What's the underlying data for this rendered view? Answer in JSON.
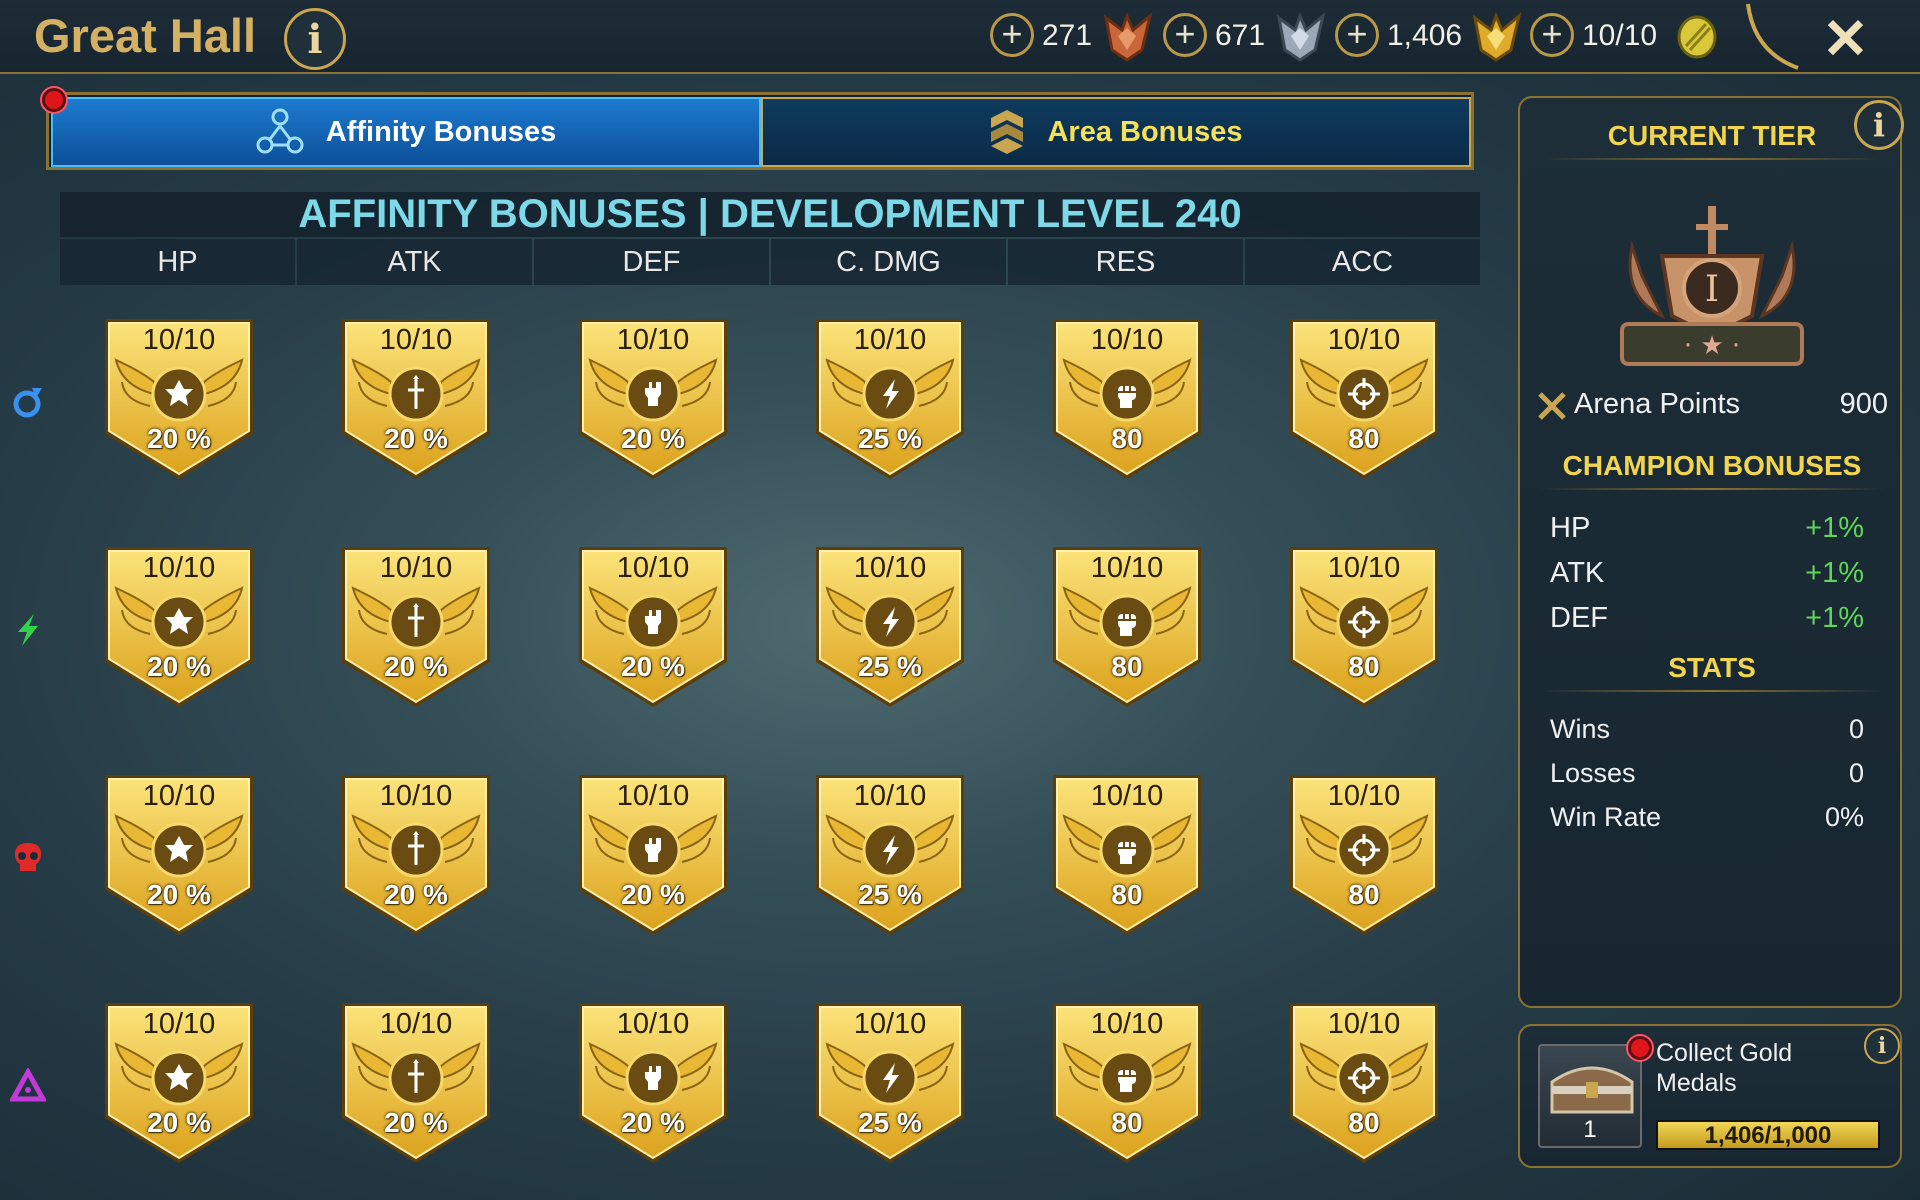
{
  "header": {
    "title": "Great Hall",
    "info": "i",
    "currencies": [
      {
        "value": "271",
        "icon": "bronze-medal-icon",
        "color": "#c9673a"
      },
      {
        "value": "671",
        "icon": "silver-medal-icon",
        "color": "#9aa8b8"
      },
      {
        "value": "1,406",
        "icon": "gold-medal-icon",
        "color": "#e0aa2a"
      },
      {
        "value": "10/10",
        "icon": "arena-token-icon",
        "color": "#d8c83a"
      }
    ],
    "plus": "+",
    "close": "✕"
  },
  "tabs": {
    "active": "Affinity Bonuses",
    "inactive": "Area Bonuses"
  },
  "panel": {
    "headline": "AFFINITY BONUSES | DEVELOPMENT LEVEL 240",
    "columns": [
      "HP",
      "ATK",
      "DEF",
      "C. DMG",
      "RES",
      "ACC"
    ]
  },
  "affinities": [
    {
      "icon": "magic-affinity-icon",
      "color": "#3a8ff0"
    },
    {
      "icon": "spirit-affinity-icon",
      "color": "#2fd44a"
    },
    {
      "icon": "force-affinity-icon",
      "color": "#e02a2a"
    },
    {
      "icon": "void-affinity-icon",
      "color": "#c33ad8"
    }
  ],
  "grid": [
    {
      "cells": [
        {
          "level": "10/10",
          "value": "20 %",
          "icon": "hp-icon"
        },
        {
          "level": "10/10",
          "value": "20 %",
          "icon": "attack-icon"
        },
        {
          "level": "10/10",
          "value": "20 %",
          "icon": "defense-icon"
        },
        {
          "level": "10/10",
          "value": "25 %",
          "icon": "crit-damage-icon"
        },
        {
          "level": "10/10",
          "value": "80",
          "icon": "resistance-icon"
        },
        {
          "level": "10/10",
          "value": "80",
          "icon": "accuracy-icon"
        }
      ]
    },
    {
      "cells": [
        {
          "level": "10/10",
          "value": "20 %",
          "icon": "hp-icon"
        },
        {
          "level": "10/10",
          "value": "20 %",
          "icon": "attack-icon"
        },
        {
          "level": "10/10",
          "value": "20 %",
          "icon": "defense-icon"
        },
        {
          "level": "10/10",
          "value": "25 %",
          "icon": "crit-damage-icon"
        },
        {
          "level": "10/10",
          "value": "80",
          "icon": "resistance-icon"
        },
        {
          "level": "10/10",
          "value": "80",
          "icon": "accuracy-icon"
        }
      ]
    },
    {
      "cells": [
        {
          "level": "10/10",
          "value": "20 %",
          "icon": "hp-icon"
        },
        {
          "level": "10/10",
          "value": "20 %",
          "icon": "attack-icon"
        },
        {
          "level": "10/10",
          "value": "20 %",
          "icon": "defense-icon"
        },
        {
          "level": "10/10",
          "value": "25 %",
          "icon": "crit-damage-icon"
        },
        {
          "level": "10/10",
          "value": "80",
          "icon": "resistance-icon"
        },
        {
          "level": "10/10",
          "value": "80",
          "icon": "accuracy-icon"
        }
      ]
    },
    {
      "cells": [
        {
          "level": "10/10",
          "value": "20 %",
          "icon": "hp-icon"
        },
        {
          "level": "10/10",
          "value": "20 %",
          "icon": "attack-icon"
        },
        {
          "level": "10/10",
          "value": "20 %",
          "icon": "defense-icon"
        },
        {
          "level": "10/10",
          "value": "25 %",
          "icon": "crit-damage-icon"
        },
        {
          "level": "10/10",
          "value": "80",
          "icon": "resistance-icon"
        },
        {
          "level": "10/10",
          "value": "80",
          "icon": "accuracy-icon"
        }
      ]
    }
  ],
  "tier": {
    "heading": "CURRENT TIER",
    "emblem": "I",
    "info": "i",
    "arena_label": "Arena Points",
    "arena_value": "900",
    "champion_heading": "CHAMPION BONUSES",
    "bonuses": [
      {
        "label": "HP",
        "value": "+1%"
      },
      {
        "label": "ATK",
        "value": "+1%"
      },
      {
        "label": "DEF",
        "value": "+1%"
      }
    ],
    "stats_heading": "STATS",
    "stats": [
      {
        "label": "Wins",
        "value": "0"
      },
      {
        "label": "Losses",
        "value": "0"
      },
      {
        "label": "Win Rate",
        "value": "0%"
      }
    ]
  },
  "medals": {
    "title": "Collect Gold Medals",
    "count": "1",
    "progress_text": "1,406/1,000",
    "progress": 1.0,
    "info": "i"
  }
}
